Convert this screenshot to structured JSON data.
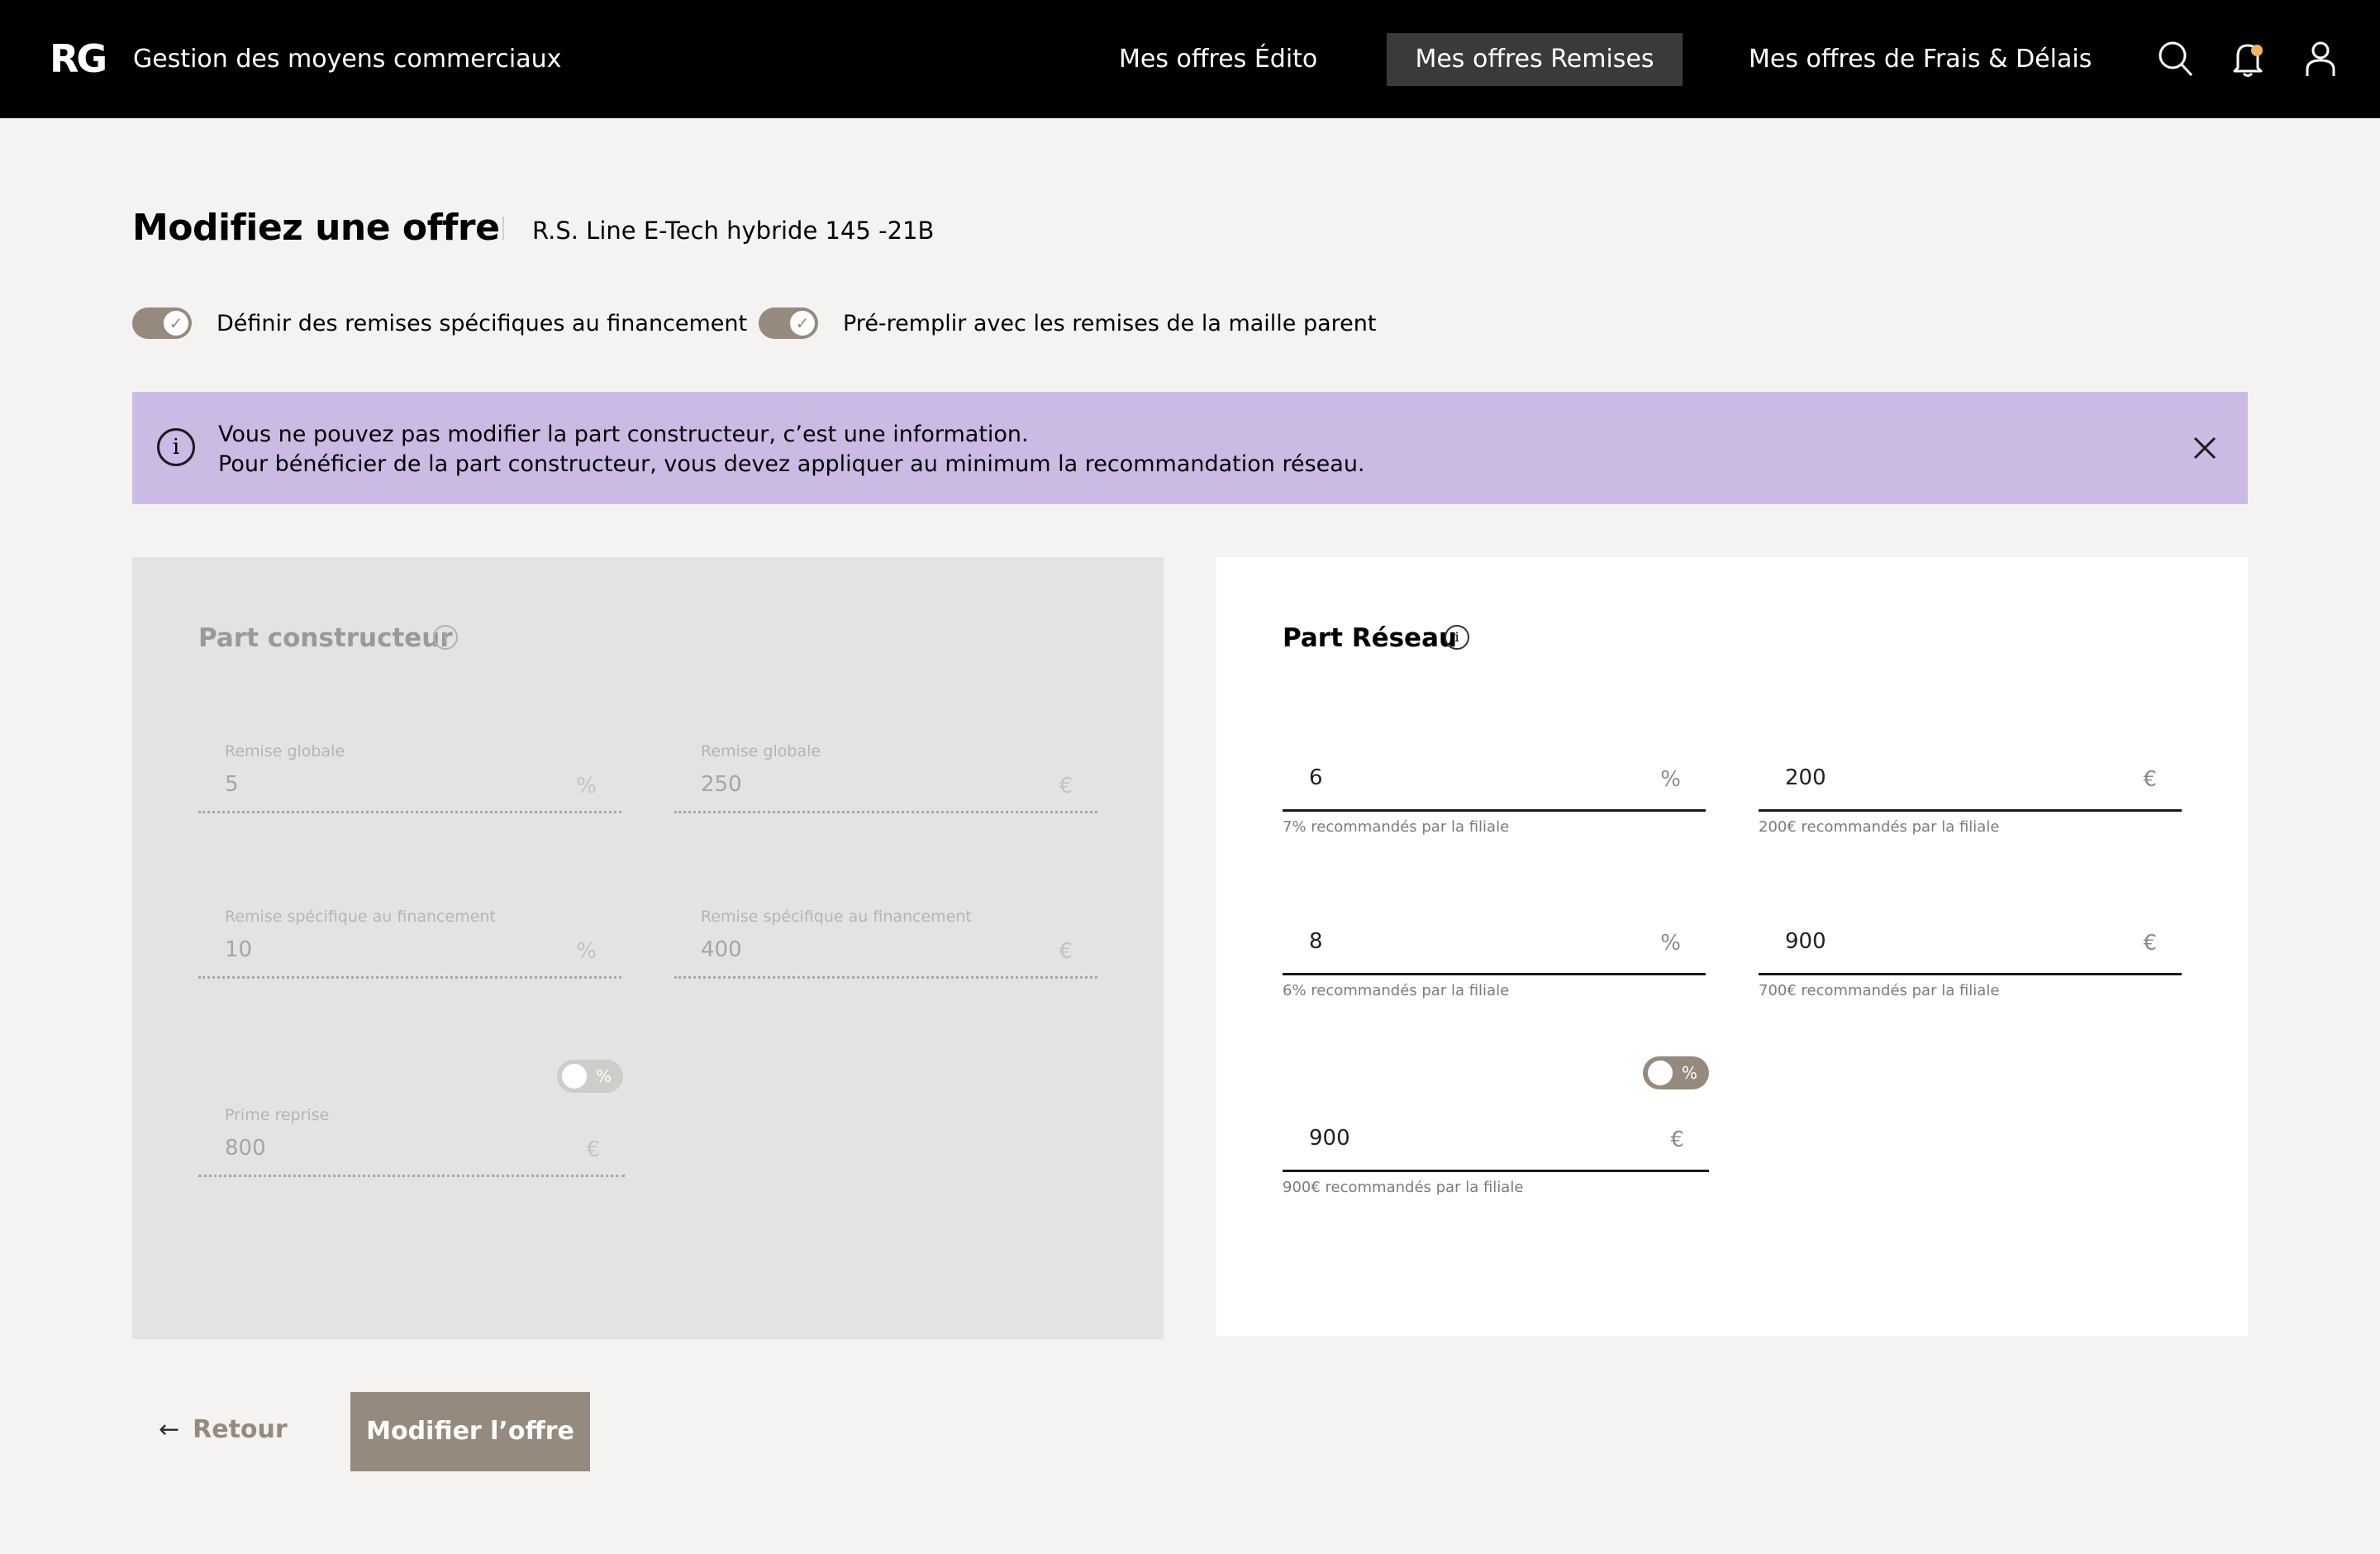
{
  "header": {
    "logo": "RG",
    "app_title": "Gestion des moyens commerciaux",
    "nav": [
      {
        "label": "Mes offres Édito",
        "active": false
      },
      {
        "label": "Mes offres Remises",
        "active": true
      },
      {
        "label": "Mes offres de Frais & Délais",
        "active": false
      }
    ],
    "icons": [
      "search-icon",
      "bell-icon",
      "user-icon"
    ],
    "notification_dot_color": "#f6b45d"
  },
  "page": {
    "title": "Modifiez une offre",
    "vehicle": "R.S. Line E-Tech hybride 145 -21B"
  },
  "toggles": [
    {
      "label": "Définir des remises spécifiques au financement",
      "checked": true
    },
    {
      "label": "Pré-remplir avec les remises de la maille parent",
      "checked": true
    }
  ],
  "banner": {
    "line1": "Vous ne pouvez pas modifier la part constructeur, c’est une information.",
    "line2": "Pour bénéficier de la part constructeur, vous devez appliquer au minimum la recommandation réseau.",
    "icon": "info-icon"
  },
  "constructeur": {
    "title": "Part constructeur",
    "remise_globale_label": "Remise globale",
    "remise_globale_pct": "5",
    "remise_globale_eur": "250",
    "remise_fin_label": "Remise spécifique au financement",
    "remise_fin_pct": "10",
    "remise_fin_eur": "400",
    "prime_label": "Prime reprise",
    "prime_value": "800",
    "toggle_label": "%"
  },
  "reseau": {
    "title": "Part Réseau",
    "row1_pct": "6",
    "row1_pct_hint": "7% recommandés par la filiale",
    "row1_eur": "200",
    "row1_eur_hint": "200€ recommandés par la filiale",
    "row2_pct": "8",
    "row2_pct_hint": "6% recommandés par la filiale",
    "row2_eur": "900",
    "row2_eur_hint": "700€ recommandés par la filiale",
    "row3_eur": "900",
    "row3_eur_hint": "900€ recommandés par la filiale",
    "toggle_label": "%"
  },
  "units": {
    "pct": "%",
    "eur": "€"
  },
  "footer": {
    "back_label": "Retour",
    "back_arrow": "←",
    "submit_label": "Modifier l’offre"
  },
  "colors": {
    "accent": "#958a7d",
    "banner": "#cbbbe4",
    "header": "#000000"
  }
}
